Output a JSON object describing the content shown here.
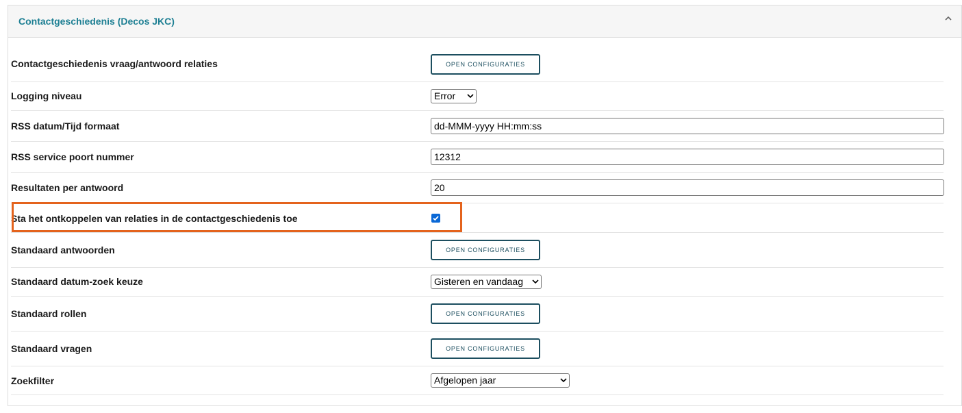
{
  "panel": {
    "title": "Contactgeschiedenis (Decos JKC)",
    "collapse_icon": "chevron-up-icon"
  },
  "rows": {
    "vraag_antwoord": {
      "label": "Contactgeschiedenis vraag/antwoord relaties",
      "button": "OPEN CONFIGURATIES"
    },
    "logging": {
      "label": "Logging niveau",
      "value": "Error"
    },
    "rss_format": {
      "label": "RSS datum/Tijd formaat",
      "value": "dd-MMM-yyyy HH:mm:ss"
    },
    "rss_port": {
      "label": "RSS service poort nummer",
      "value": "12312"
    },
    "results": {
      "label": "Resultaten per antwoord",
      "value": "20"
    },
    "ontkoppelen": {
      "label": "Sta het ontkoppelen van relaties in de contactgeschiedenis toe",
      "checked": true
    },
    "std_antwoorden": {
      "label": "Standaard antwoorden",
      "button": "OPEN CONFIGURATIES"
    },
    "std_datum": {
      "label": "Standaard datum-zoek keuze",
      "value": "Gisteren en vandaag"
    },
    "std_rollen": {
      "label": "Standaard rollen",
      "button": "OPEN CONFIGURATIES"
    },
    "std_vragen": {
      "label": "Standaard vragen",
      "button": "OPEN CONFIGURATIES"
    },
    "zoekfilter": {
      "label": "Zoekfilter",
      "value": "Afgelopen jaar"
    }
  },
  "colors": {
    "title": "#1d7f93",
    "button_border": "#1c4e5f",
    "highlight": "#e4631d",
    "checkbox": "#0a68d6"
  }
}
